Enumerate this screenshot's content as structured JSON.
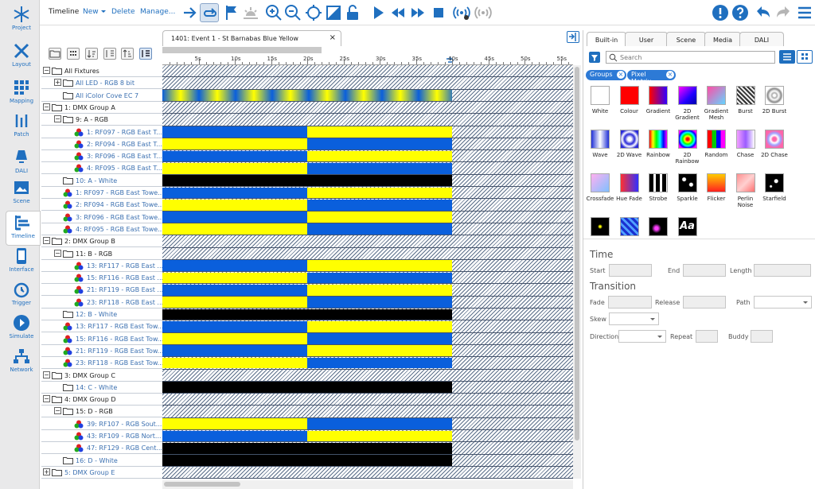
{
  "sidebar": [
    {
      "label": "Project",
      "icon": "snowflake-icon"
    },
    {
      "label": "Layout",
      "icon": "layout-tools-icon"
    },
    {
      "label": "Mapping",
      "icon": "mapping-grid-icon"
    },
    {
      "label": "Patch",
      "icon": "patch-icon"
    },
    {
      "label": "DALI",
      "icon": "dali-lamp-icon"
    },
    {
      "label": "Scene",
      "icon": "scene-image-icon"
    },
    {
      "label": "Timeline",
      "icon": "timeline-icon"
    },
    {
      "label": "Interface",
      "icon": "interface-icon"
    },
    {
      "label": "Trigger",
      "icon": "trigger-clock-icon"
    },
    {
      "label": "Simulate",
      "icon": "simulate-play-icon"
    },
    {
      "label": "Network",
      "icon": "network-icon"
    }
  ],
  "toolbar": {
    "title": "Timeline",
    "new": "New",
    "delete": "Delete",
    "manage": "Manage..."
  },
  "timeline": {
    "tab_title": "1401: Event 1 - St Barnabas Blue Yellow",
    "tab_close": "×",
    "ticks": [
      "5s",
      "10s",
      "15s",
      "20s",
      "25s",
      "30s",
      "35s",
      "40s",
      "45s",
      "50s",
      "55s"
    ],
    "rows": [
      {
        "label": "All Fixtures",
        "indent": 0,
        "type": "group",
        "expand": "−",
        "blue": false,
        "pattern": "hatch"
      },
      {
        "label": "All LED - RGB 8 bit",
        "indent": 1,
        "type": "group",
        "expand": "+",
        "blue": true,
        "pattern": "hatch"
      },
      {
        "label": "All iColor Cove EC 7",
        "indent": 1,
        "type": "group",
        "expand": "",
        "blue": true,
        "pattern": "gradient"
      },
      {
        "label": "1: DMX Group A",
        "indent": 0,
        "type": "group",
        "expand": "−",
        "blue": false,
        "pattern": "hatch"
      },
      {
        "label": "9: A - RGB",
        "indent": 1,
        "type": "group",
        "expand": "−",
        "blue": false,
        "pattern": "hatch"
      },
      {
        "label": "1: RF097 - RGB East T...",
        "indent": 2,
        "type": "rgb",
        "expand": "",
        "blue": true,
        "pattern": "by"
      },
      {
        "label": "2: RF094 - RGB East T...",
        "indent": 2,
        "type": "rgb",
        "expand": "",
        "blue": true,
        "pattern": "yb"
      },
      {
        "label": "3: RF096 - RGB East T...",
        "indent": 2,
        "type": "rgb",
        "expand": "",
        "blue": true,
        "pattern": "by"
      },
      {
        "label": "4: RF095 - RGB East T...",
        "indent": 2,
        "type": "rgb",
        "expand": "",
        "blue": true,
        "pattern": "yb"
      },
      {
        "label": "10: A - White",
        "indent": 1,
        "type": "group",
        "expand": "",
        "blue": true,
        "pattern": "black"
      },
      {
        "label": "1: RF097 - RGB East Towe...",
        "indent": 1,
        "type": "rgb",
        "expand": "",
        "blue": true,
        "pattern": "by"
      },
      {
        "label": "2: RF094 - RGB East Towe...",
        "indent": 1,
        "type": "rgb",
        "expand": "",
        "blue": true,
        "pattern": "yb"
      },
      {
        "label": "3: RF096 - RGB East Towe...",
        "indent": 1,
        "type": "rgb",
        "expand": "",
        "blue": true,
        "pattern": "by"
      },
      {
        "label": "4: RF095 - RGB East Towe...",
        "indent": 1,
        "type": "rgb",
        "expand": "",
        "blue": true,
        "pattern": "yb"
      },
      {
        "label": "2: DMX Group B",
        "indent": 0,
        "type": "group",
        "expand": "−",
        "blue": false,
        "pattern": "hatch"
      },
      {
        "label": "11: B - RGB",
        "indent": 1,
        "type": "group",
        "expand": "−",
        "blue": false,
        "pattern": "hatch"
      },
      {
        "label": "13: RF117 - RGB East ...",
        "indent": 2,
        "type": "rgb",
        "expand": "",
        "blue": true,
        "pattern": "by"
      },
      {
        "label": "15: RF116 - RGB East ...",
        "indent": 2,
        "type": "rgb",
        "expand": "",
        "blue": true,
        "pattern": "yb"
      },
      {
        "label": "21: RF119 - RGB East ...",
        "indent": 2,
        "type": "rgb",
        "expand": "",
        "blue": true,
        "pattern": "by"
      },
      {
        "label": "23: RF118 - RGB East ...",
        "indent": 2,
        "type": "rgb",
        "expand": "",
        "blue": true,
        "pattern": "yb"
      },
      {
        "label": "12: B - White",
        "indent": 1,
        "type": "group",
        "expand": "",
        "blue": true,
        "pattern": "black"
      },
      {
        "label": "13: RF117 - RGB East Tow...",
        "indent": 1,
        "type": "rgb",
        "expand": "",
        "blue": true,
        "pattern": "by"
      },
      {
        "label": "15: RF116 - RGB East Tow...",
        "indent": 1,
        "type": "rgb",
        "expand": "",
        "blue": true,
        "pattern": "yb"
      },
      {
        "label": "21: RF119 - RGB East Tow...",
        "indent": 1,
        "type": "rgb",
        "expand": "",
        "blue": true,
        "pattern": "by"
      },
      {
        "label": "23: RF118 - RGB East Tow...",
        "indent": 1,
        "type": "rgb",
        "expand": "",
        "blue": true,
        "pattern": "yb"
      },
      {
        "label": "3: DMX Group C",
        "indent": 0,
        "type": "group",
        "expand": "−",
        "blue": false,
        "pattern": "hatch"
      },
      {
        "label": "14: C - White",
        "indent": 1,
        "type": "group",
        "expand": "",
        "blue": true,
        "pattern": "black"
      },
      {
        "label": "4: DMX Group D",
        "indent": 0,
        "type": "group",
        "expand": "−",
        "blue": false,
        "pattern": "hatch"
      },
      {
        "label": "15: D - RGB",
        "indent": 1,
        "type": "group",
        "expand": "−",
        "blue": false,
        "pattern": "hatch"
      },
      {
        "label": "39: RF107 - RGB Sout...",
        "indent": 2,
        "type": "rgb",
        "expand": "",
        "blue": true,
        "pattern": "yb"
      },
      {
        "label": "43: RF109 - RGB Nort...",
        "indent": 2,
        "type": "rgb",
        "expand": "",
        "blue": true,
        "pattern": "by"
      },
      {
        "label": "47: RF129 - RGB Cent...",
        "indent": 2,
        "type": "rgb",
        "expand": "",
        "blue": true,
        "pattern": "black"
      },
      {
        "label": "16: D - White",
        "indent": 1,
        "type": "group",
        "expand": "",
        "blue": true,
        "pattern": "black"
      },
      {
        "label": "5: DMX Group E",
        "indent": 0,
        "type": "group",
        "expand": "+",
        "blue": true,
        "pattern": "hatch"
      }
    ]
  },
  "colors": {
    "blue": "#0a5fdc",
    "yellow": "#ffff00",
    "black": "#000000",
    "accent": "#2d7ad6"
  },
  "right_panel": {
    "tabs": [
      "Built-in",
      "User",
      "Scene",
      "Media",
      "DALI"
    ],
    "search_placeholder": "Search",
    "chips": [
      "Groups",
      "Pixel Matrix"
    ],
    "chip_close": "×",
    "effects": [
      {
        "label": "White",
        "icon": "white-effect-icon"
      },
      {
        "label": "Colour",
        "icon": "colour-effect-icon"
      },
      {
        "label": "Gradient",
        "icon": "gradient-effect-icon"
      },
      {
        "label": "2D Gradient",
        "icon": "2d-gradient-effect-icon"
      },
      {
        "label": "Gradient Mesh",
        "icon": "gradient-mesh-effect-icon"
      },
      {
        "label": "Burst",
        "icon": "burst-effect-icon"
      },
      {
        "label": "2D Burst",
        "icon": "2d-burst-effect-icon"
      },
      {
        "label": "Wave",
        "icon": "wave-effect-icon"
      },
      {
        "label": "2D Wave",
        "icon": "2d-wave-effect-icon"
      },
      {
        "label": "Rainbow",
        "icon": "rainbow-effect-icon"
      },
      {
        "label": "2D Rainbow",
        "icon": "2d-rainbow-effect-icon"
      },
      {
        "label": "Random",
        "icon": "random-effect-icon"
      },
      {
        "label": "Chase",
        "icon": "chase-effect-icon"
      },
      {
        "label": "2D Chase",
        "icon": "2d-chase-effect-icon"
      },
      {
        "label": "Crossfade",
        "icon": "crossfade-effect-icon"
      },
      {
        "label": "Hue Fade",
        "icon": "hue-fade-effect-icon"
      },
      {
        "label": "Strobe",
        "icon": "strobe-effect-icon"
      },
      {
        "label": "Sparkle",
        "icon": "sparkle-effect-icon"
      },
      {
        "label": "Flicker",
        "icon": "flicker-effect-icon"
      },
      {
        "label": "Perlin Noise",
        "icon": "perlin-noise-effect-icon"
      },
      {
        "label": "Starfield",
        "icon": "starfield-effect-icon"
      },
      {
        "label": "",
        "icon": "fireworks-effect-icon"
      },
      {
        "label": "",
        "icon": "pixel-noise-effect-icon"
      },
      {
        "label": "",
        "icon": "swirl-effect-icon"
      },
      {
        "label": "",
        "icon": "text-effect-icon",
        "glyph": "Aa"
      }
    ],
    "time_title": "Time",
    "start_label": "Start",
    "end_label": "End",
    "length_label": "Length",
    "transition_title": "Transition",
    "fade_label": "Fade",
    "release_label": "Release",
    "path_label": "Path",
    "skew_label": "Skew",
    "direction_label": "Direction",
    "repeat_label": "Repeat",
    "buddy_label": "Buddy"
  }
}
